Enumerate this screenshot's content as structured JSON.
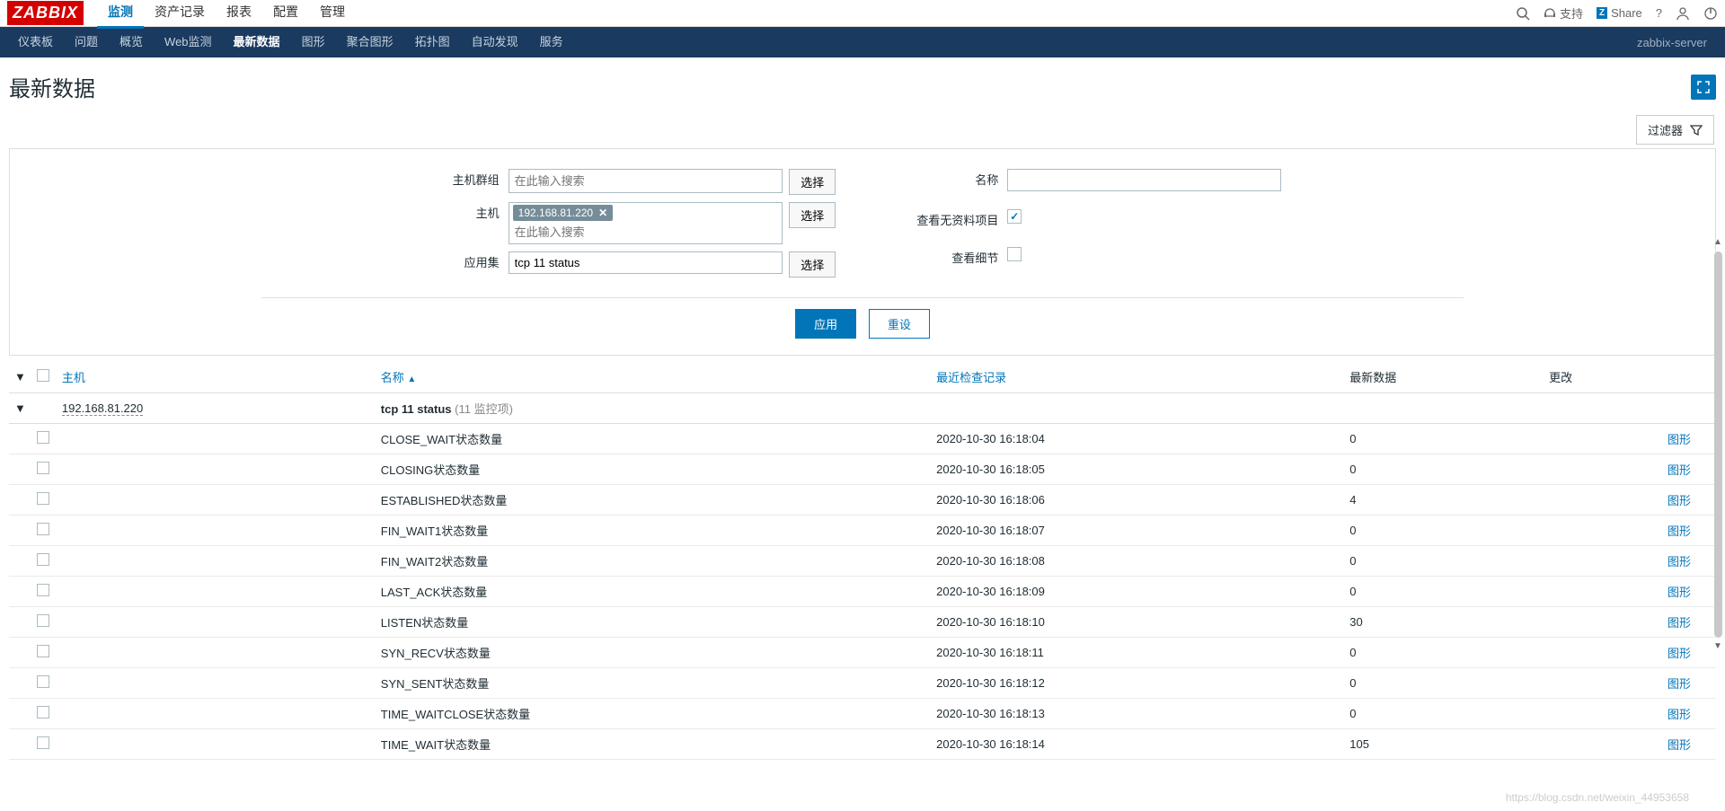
{
  "logo": "ZABBIX",
  "topnav": [
    "监测",
    "资产记录",
    "报表",
    "配置",
    "管理"
  ],
  "topnav_active": 0,
  "topright": {
    "support": "支持",
    "share": "Share"
  },
  "secnav": [
    "仪表板",
    "问题",
    "概览",
    "Web监测",
    "最新数据",
    "图形",
    "聚合图形",
    "拓扑图",
    "自动发现",
    "服务"
  ],
  "secnav_active": 4,
  "server_name": "zabbix-server",
  "page_title": "最新数据",
  "filter_label": "过滤器",
  "filter": {
    "hostgroup_label": "主机群组",
    "hostgroup_placeholder": "在此输入搜索",
    "host_label": "主机",
    "host_tag": "192.168.81.220",
    "host_placeholder": "在此输入搜索",
    "appset_label": "应用集",
    "appset_value": "tcp 11 status",
    "select_btn": "选择",
    "name_label": "名称",
    "name_value": "",
    "show_nodata_label": "查看无资料项目",
    "show_nodata": true,
    "show_detail_label": "查看细节",
    "show_detail": false,
    "apply": "应用",
    "reset": "重设"
  },
  "table": {
    "headers": {
      "host": "主机",
      "name": "名称",
      "lastcheck": "最近检查记录",
      "lastdata": "最新数据",
      "change": "更改"
    },
    "group": {
      "host": "192.168.81.220",
      "app": "tcp 11 status",
      "count": "(11 监控项)"
    },
    "graph_link": "图形",
    "rows": [
      {
        "name": "CLOSE_WAIT状态数量",
        "check": "2020-10-30 16:18:04",
        "val": "0"
      },
      {
        "name": "CLOSING状态数量",
        "check": "2020-10-30 16:18:05",
        "val": "0"
      },
      {
        "name": "ESTABLISHED状态数量",
        "check": "2020-10-30 16:18:06",
        "val": "4"
      },
      {
        "name": "FIN_WAIT1状态数量",
        "check": "2020-10-30 16:18:07",
        "val": "0"
      },
      {
        "name": "FIN_WAIT2状态数量",
        "check": "2020-10-30 16:18:08",
        "val": "0"
      },
      {
        "name": "LAST_ACK状态数量",
        "check": "2020-10-30 16:18:09",
        "val": "0"
      },
      {
        "name": "LISTEN状态数量",
        "check": "2020-10-30 16:18:10",
        "val": "30"
      },
      {
        "name": "SYN_RECV状态数量",
        "check": "2020-10-30 16:18:11",
        "val": "0"
      },
      {
        "name": "SYN_SENT状态数量",
        "check": "2020-10-30 16:18:12",
        "val": "0"
      },
      {
        "name": "TIME_WAITCLOSE状态数量",
        "check": "2020-10-30 16:18:13",
        "val": "0"
      },
      {
        "name": "TIME_WAIT状态数量",
        "check": "2020-10-30 16:18:14",
        "val": "105"
      }
    ]
  },
  "watermark": "https://blog.csdn.net/weixin_44953658"
}
